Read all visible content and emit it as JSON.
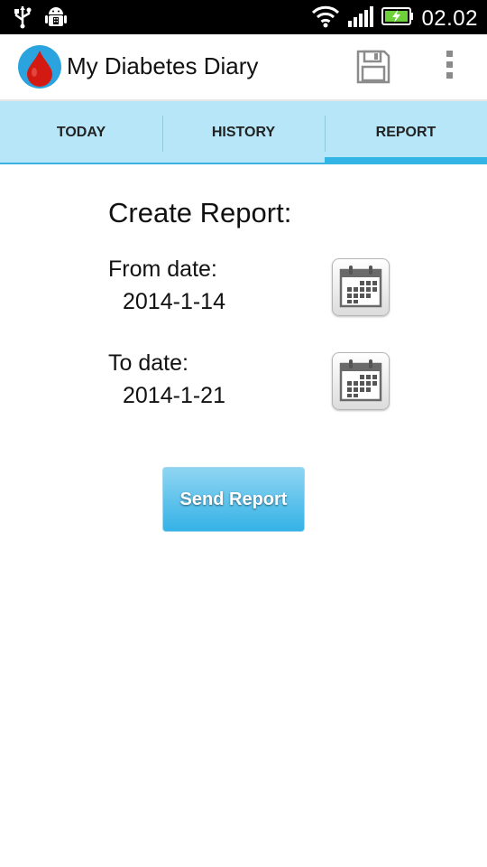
{
  "status_bar": {
    "time": "02.02",
    "icons": [
      "usb-icon",
      "android-debug-icon",
      "wifi-icon",
      "signal-icon",
      "battery-charging-icon"
    ]
  },
  "action_bar": {
    "title": "My Diabetes Diary",
    "logo_icon": "blood-drop-icon",
    "actions": [
      "save-icon",
      "overflow-menu-icon"
    ]
  },
  "tabs": [
    {
      "label": "TODAY",
      "active": false
    },
    {
      "label": "HISTORY",
      "active": false
    },
    {
      "label": "REPORT",
      "active": true
    }
  ],
  "report": {
    "heading": "Create Report:",
    "from_label": "From date:",
    "from_value": "2014-1-14",
    "to_label": "To date:",
    "to_value": "2014-1-21",
    "calendar_icon": "calendar-icon",
    "send_label": "Send Report"
  },
  "colors": {
    "tab_background": "#b7e6f8",
    "accent": "#33b5e5",
    "logo_background": "#2ba3df",
    "drop_red": "#d31a12"
  }
}
